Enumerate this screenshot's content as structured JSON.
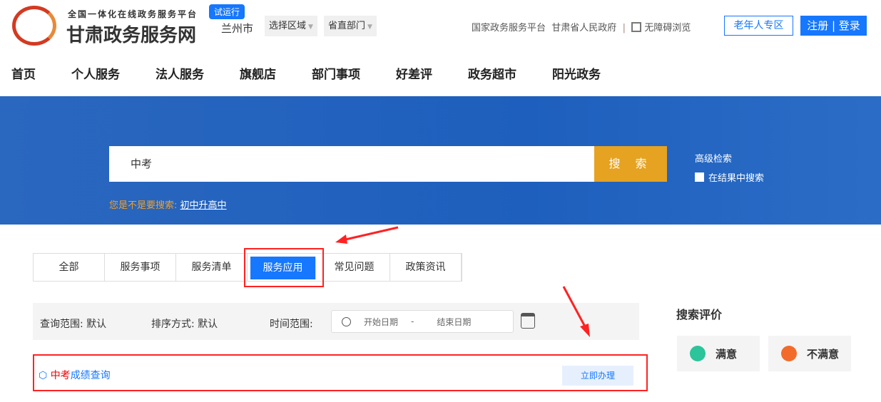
{
  "header": {
    "logo_sub": "全国一体化在线政务服务平台",
    "logo_main": "甘肃政务服务网",
    "trial_badge": "试运行",
    "city": "兰州市",
    "region_select": "选择区域",
    "dept_select": "省直部门",
    "links": [
      "国家政务服务平台",
      "甘肃省人民政府"
    ],
    "accessible": "无障碍浏览",
    "elder_button": "老年人专区",
    "register": "注册",
    "login": "登录"
  },
  "nav": [
    "首页",
    "个人服务",
    "法人服务",
    "旗舰店",
    "部门事项",
    "好差评",
    "政务超市",
    "阳光政务"
  ],
  "search": {
    "value": "中考",
    "button": "搜 索",
    "advanced": "高级检索",
    "in_results": "在结果中搜索",
    "suggest_label": "您是不是要搜索:",
    "suggest_term": "初中升高中"
  },
  "tabs": [
    "全部",
    "服务事项",
    "服务清单",
    "服务应用",
    "常见问题",
    "政策资讯"
  ],
  "filter": {
    "scope": "查询范围: 默认",
    "sort": "排序方式: 默认",
    "time_label": "时间范围:",
    "start": "开始日期",
    "sep": "-",
    "end": "结束日期"
  },
  "result": {
    "keyword": "中考",
    "rest": "成绩查询",
    "action": "立即办理"
  },
  "evaluation": {
    "title": "搜索评价",
    "good": "满意",
    "bad": "不满意"
  }
}
